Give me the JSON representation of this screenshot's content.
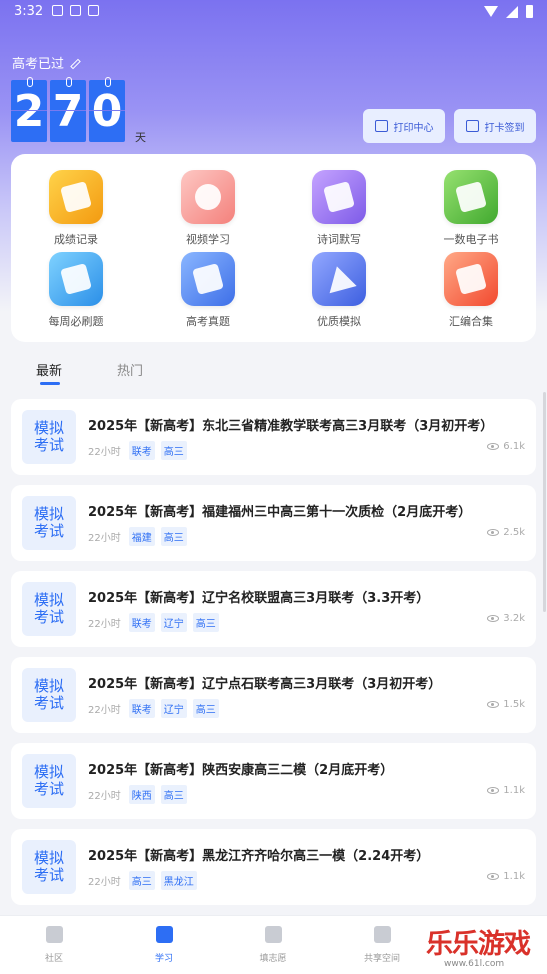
{
  "status_bar": {
    "time": "3:32"
  },
  "header": {
    "since_label": "高考已过",
    "digits": [
      "2",
      "7",
      "0"
    ],
    "unit": "天",
    "print_button": "打印中心",
    "checkin_button": "打卡签到"
  },
  "features": [
    {
      "label": "成绩记录",
      "icon": "notepad-icon",
      "color": "#f7b21a"
    },
    {
      "label": "视频学习",
      "icon": "video-icon",
      "color": "#f6a3a0"
    },
    {
      "label": "诗词默写",
      "icon": "pen-icon",
      "color": "#9c7df0"
    },
    {
      "label": "一数电子书",
      "icon": "book-icon",
      "color": "#6ac24b"
    },
    {
      "label": "每周必刷题",
      "icon": "paper-icon",
      "color": "#4aaef0"
    },
    {
      "label": "高考真题",
      "icon": "scroll-icon",
      "color": "#5a8ef5"
    },
    {
      "label": "优质模拟",
      "icon": "paper-plane-icon",
      "color": "#5c7ef2"
    },
    {
      "label": "汇编合集",
      "icon": "books-icon",
      "color": "#fa6d4c"
    }
  ],
  "tabs": {
    "new": "最新",
    "hot": "热门"
  },
  "articles": [
    {
      "badge1": "模拟",
      "badge2": "考试",
      "title": "2025年【新高考】东北三省精准教学联考高三3月联考（3月初开考）",
      "ago": "22小时",
      "tags": [
        "联考",
        "高三"
      ],
      "views": "6.1k"
    },
    {
      "badge1": "模拟",
      "badge2": "考试",
      "title": "2025年【新高考】福建福州三中高三第十一次质检（2月底开考）",
      "ago": "22小时",
      "tags": [
        "福建",
        "高三"
      ],
      "views": "2.5k"
    },
    {
      "badge1": "模拟",
      "badge2": "考试",
      "title": "2025年【新高考】辽宁名校联盟高三3月联考（3.3开考）",
      "ago": "22小时",
      "tags": [
        "联考",
        "辽宁",
        "高三"
      ],
      "views": "3.2k"
    },
    {
      "badge1": "模拟",
      "badge2": "考试",
      "title": "2025年【新高考】辽宁点石联考高三3月联考（3月初开考）",
      "ago": "22小时",
      "tags": [
        "联考",
        "辽宁",
        "高三"
      ],
      "views": "1.5k"
    },
    {
      "badge1": "模拟",
      "badge2": "考试",
      "title": "2025年【新高考】陕西安康高三二模（2月底开考）",
      "ago": "22小时",
      "tags": [
        "陕西",
        "高三"
      ],
      "views": "1.1k"
    },
    {
      "badge1": "模拟",
      "badge2": "考试",
      "title": "2025年【新高考】黑龙江齐齐哈尔高三一模（2.24开考）",
      "ago": "22小时",
      "tags": [
        "高三",
        "黑龙江"
      ],
      "views": "1.1k"
    }
  ],
  "bottom_nav": [
    {
      "label": "社区",
      "icon": "home-icon"
    },
    {
      "label": "学习",
      "icon": "study-icon",
      "active": true
    },
    {
      "label": "填志愿",
      "icon": "form-icon"
    },
    {
      "label": "共享空间",
      "icon": "folder-icon"
    }
  ],
  "watermark": {
    "text": "乐乐游戏",
    "url": "www.61l.com"
  },
  "colors": {
    "primary": "#2d6ef4",
    "hero_top": "#7b72f0",
    "tag_bg": "#eaf1fd"
  }
}
